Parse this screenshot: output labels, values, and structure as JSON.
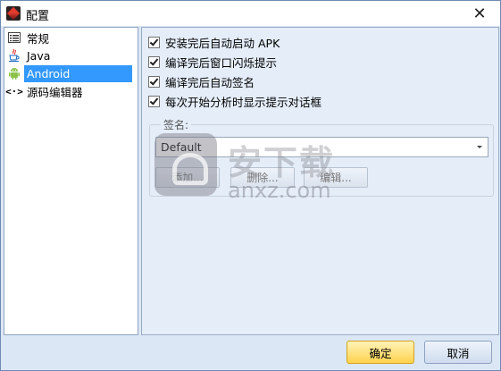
{
  "window": {
    "title": "配置",
    "close_glyph": "✕"
  },
  "tree": {
    "items": [
      {
        "label": "常规",
        "icon": "list-icon"
      },
      {
        "label": "Java",
        "icon": "java-cup-icon"
      },
      {
        "label": "Android",
        "icon": "android-icon",
        "selected": true
      },
      {
        "label": "源码编辑器",
        "icon": "code-brackets-icon",
        "glyph": "<·>"
      }
    ]
  },
  "options": [
    {
      "label": "安装完后自动启动 APK",
      "checked": true
    },
    {
      "label": "编译完后窗口闪烁提示",
      "checked": true
    },
    {
      "label": "编译完后自动签名",
      "checked": true
    },
    {
      "label": "每次开始分析时显示提示对话框",
      "checked": true
    }
  ],
  "signature": {
    "group_title": "签名:",
    "selected": "Default",
    "add_label": "添加...",
    "delete_label": "删除...",
    "edit_label": "编辑..."
  },
  "watermark": {
    "cn": "安下载",
    "en": "anxz.com"
  },
  "footer": {
    "ok_label": "确定",
    "cancel_label": "取消"
  },
  "colors": {
    "selection": "#3399ff",
    "ok_button": "#ffd24d",
    "android_green": "#8bc34a"
  }
}
